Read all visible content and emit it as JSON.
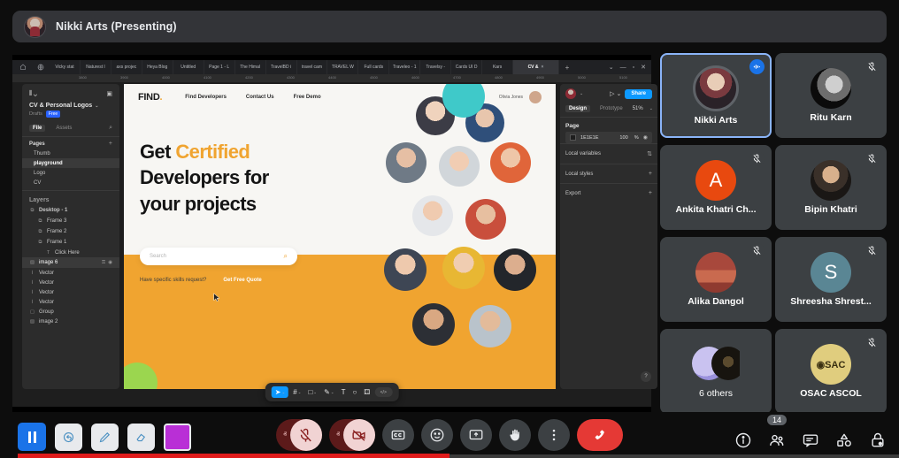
{
  "header": {
    "title": "Nikki Arts (Presenting)",
    "avatar": "presenter-avatar"
  },
  "shared_screen": {
    "browser": {
      "tabs": [
        "Vicky stat",
        "Naturest l",
        "axs projec",
        "Heya Blog",
        "Untitled",
        "Page 1 - L",
        "The Himal",
        "TravelBD i",
        "travel cam",
        "TRAVEL W",
        "Full cards",
        "Traveleo - 1",
        "Travelsy -",
        "Cards UI D",
        "Kars"
      ],
      "active_tab": "CV &",
      "close_label": "×",
      "new_tab_label": "+",
      "ruler_ticks": [
        "3800",
        "3900",
        "4000",
        "4100",
        "4200",
        "4300",
        "4400",
        "4500",
        "4600",
        "4700",
        "4800",
        "4900",
        "5000",
        "5100"
      ]
    },
    "figma_left": {
      "file_name": "CV & Personal Logos",
      "drafts_label": "Drafts",
      "plan_badge": "Free",
      "tabs": [
        "File",
        "Assets"
      ],
      "active_tab": "File",
      "search_icon": "search-icon",
      "pages_label": "Pages",
      "add_page_label": "+",
      "pages": [
        "Thumb",
        "playground",
        "Logo",
        "CV"
      ],
      "selected_page": "playground",
      "layers_label": "Layers",
      "layers": [
        {
          "name": "Desktop - 1",
          "indent": 0,
          "icon": "frame-icon",
          "selected": false
        },
        {
          "name": "Frame 3",
          "indent": 1,
          "icon": "frame-icon",
          "selected": false
        },
        {
          "name": "Frame 2",
          "indent": 1,
          "icon": "frame-icon",
          "selected": false
        },
        {
          "name": "Frame 1",
          "indent": 1,
          "icon": "frame-icon",
          "selected": false
        },
        {
          "name": "Click Here",
          "indent": 2,
          "icon": "text-icon",
          "selected": false
        },
        {
          "name": "image 6",
          "indent": 0,
          "icon": "image-icon",
          "selected": true
        },
        {
          "name": "Vector",
          "indent": 0,
          "icon": "vector-icon",
          "selected": false
        },
        {
          "name": "Vector",
          "indent": 0,
          "icon": "vector-icon",
          "selected": false
        },
        {
          "name": "Vector",
          "indent": 0,
          "icon": "vector-icon",
          "selected": false
        },
        {
          "name": "Vector",
          "indent": 0,
          "icon": "vector-icon",
          "selected": false
        },
        {
          "name": "Group",
          "indent": 0,
          "icon": "group-icon",
          "selected": false
        },
        {
          "name": "image 2",
          "indent": 0,
          "icon": "image-icon",
          "selected": false
        }
      ]
    },
    "figma_right": {
      "share_label": "Share",
      "tabs": [
        "Design",
        "Prototype"
      ],
      "active_tab": "Design",
      "zoom": "51%",
      "page_section": "Page",
      "page_color_hex": "1E1E1E",
      "page_opacity": "100",
      "page_opacity_unit": "%",
      "rows": [
        {
          "label": "Local variables",
          "action": "sort-icon"
        },
        {
          "label": "Local styles",
          "action": "+"
        },
        {
          "label": "Export",
          "action": "+"
        }
      ],
      "help_label": "?"
    },
    "figma_toolbar": [
      {
        "name": "move-tool",
        "glyph": "➤",
        "active": true,
        "caret": true
      },
      {
        "name": "frame-tool",
        "glyph": "#",
        "active": false,
        "caret": true
      },
      {
        "name": "shape-tool",
        "glyph": "□",
        "active": false,
        "caret": true
      },
      {
        "name": "pen-tool",
        "glyph": "✎",
        "active": false,
        "caret": true
      },
      {
        "name": "text-tool",
        "glyph": "T",
        "active": false,
        "caret": false
      },
      {
        "name": "comment-tool",
        "glyph": "○",
        "active": false,
        "caret": false
      },
      {
        "name": "components-tool",
        "glyph": "⚃",
        "active": false,
        "caret": false
      }
    ],
    "figma_devmode_label": "</>",
    "website": {
      "logo": "FIND",
      "logo_dot": ".",
      "nav": [
        "Find Developers",
        "Contact Us",
        "Free Demo"
      ],
      "account_name": "Olivia Jones",
      "heading_line1_plain": "Get ",
      "heading_line1_highlight": "Certified",
      "heading_line2": "Developers for",
      "heading_line3": "your projects",
      "search_placeholder": "Search",
      "search_icon": "magnifier-icon",
      "quote_question": "Have specific skills request?",
      "quote_button": "Get Free Quote",
      "accent_color": "#f0a430"
    }
  },
  "participants": [
    {
      "name": "Nikki Arts",
      "avatar_type": "photo",
      "photo": "woman-portrait",
      "mic": "speaking",
      "active": true
    },
    {
      "name": "Ritu Karn",
      "avatar_type": "photo",
      "photo": "bw-portrait",
      "mic": "muted",
      "active": false
    },
    {
      "name": "Ankita Khatri Ch...",
      "avatar_type": "initial",
      "initial": "A",
      "color": "#e8490f",
      "mic": "muted",
      "active": false
    },
    {
      "name": "Bipin Khatri",
      "avatar_type": "photo",
      "photo": "man-portrait",
      "mic": "muted",
      "active": false
    },
    {
      "name": "Alika Dangol",
      "avatar_type": "photo",
      "photo": "red-scene",
      "mic": "muted",
      "active": false
    },
    {
      "name": "Shreesha Shrest...",
      "avatar_type": "initial",
      "initial": "S",
      "color": "#5a8694",
      "mic": "muted",
      "active": false
    },
    {
      "name": "6 others",
      "avatar_type": "stack",
      "mic": "none",
      "active": false
    },
    {
      "name": "OSAC ASCOL",
      "avatar_type": "logo",
      "logo_text": "SAC",
      "color": "#e0cd7e",
      "mic": "muted",
      "active": false
    }
  ],
  "annotation_toolbar": [
    {
      "name": "pause-presentation-button",
      "icon": "pause-icon"
    },
    {
      "name": "undo-annotation-button",
      "icon": "undo-arrow-icon"
    },
    {
      "name": "pen-button",
      "icon": "pencil-icon"
    },
    {
      "name": "eraser-button",
      "icon": "eraser-icon"
    },
    {
      "name": "color-swatch-button",
      "icon": "color-swatch",
      "color": "#b92fd6"
    }
  ],
  "controls": {
    "mic": {
      "state": "muted",
      "icon": "mic-off-icon",
      "caret": "ⱏ"
    },
    "camera": {
      "state": "off",
      "icon": "camera-off-icon",
      "caret": "ⱏ"
    },
    "captions": {
      "icon": "cc-icon"
    },
    "reactions": {
      "icon": "emoji-icon"
    },
    "present": {
      "icon": "present-screen-icon"
    },
    "raise_hand": {
      "icon": "raise-hand-icon"
    },
    "more": {
      "icon": "more-vertical-icon"
    },
    "end_call": {
      "icon": "end-call-icon"
    }
  },
  "right_controls": [
    {
      "name": "meeting-details-button",
      "icon": "info-icon",
      "badge": ""
    },
    {
      "name": "people-button",
      "icon": "people-icon",
      "badge": "14"
    },
    {
      "name": "chat-button",
      "icon": "chat-icon",
      "badge": ""
    },
    {
      "name": "activities-button",
      "icon": "activities-icon",
      "badge": ""
    },
    {
      "name": "host-controls-button",
      "icon": "lock-icon",
      "badge": ""
    }
  ]
}
